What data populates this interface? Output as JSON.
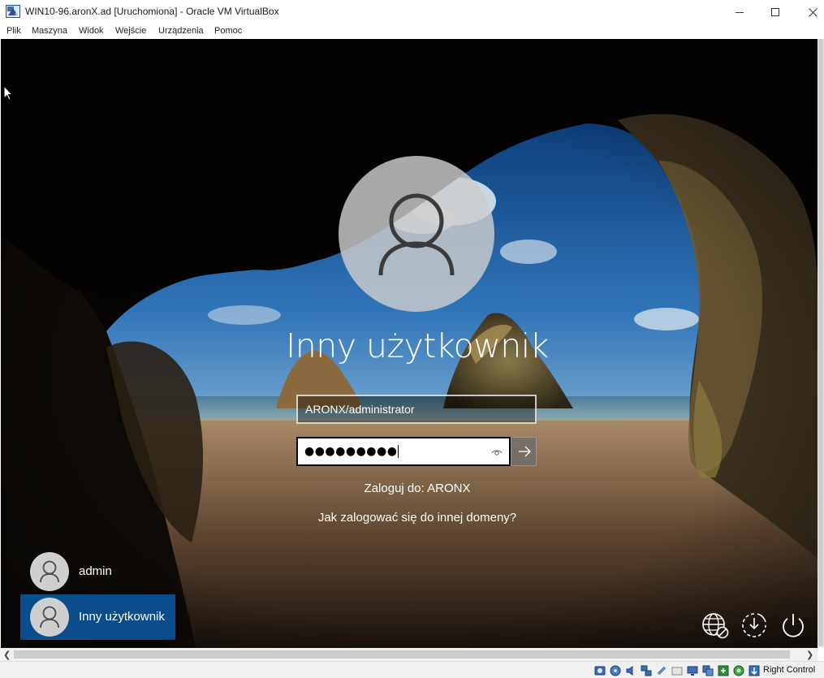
{
  "window": {
    "title": "WIN10-96.aronX.ad [Uruchomiona] - Oracle VM VirtualBox",
    "app_icon": "virtualbox-icon",
    "controls": [
      "minimize-icon",
      "maximize-icon",
      "close-icon"
    ]
  },
  "menu": {
    "items": [
      "Plik",
      "Maszyna",
      "Widok",
      "Wejście",
      "Urządzenia",
      "Pomoc"
    ]
  },
  "login": {
    "avatar_icon": "user-icon",
    "user_title": "Inny użytkownik",
    "username_value": "ARONX/administrator",
    "password_mask": "●●●●●●●●●",
    "reveal_icon": "eye-icon",
    "submit_icon": "arrow-right-icon",
    "domain_text": "Zaloguj do: ARONX",
    "other_domain_link": "Jak zalogować się do innej domeny?"
  },
  "user_list": [
    {
      "name": "admin",
      "selected": false
    },
    {
      "name": "Inny użytkownik",
      "selected": true
    }
  ],
  "system_buttons": [
    "network-icon",
    "ease-of-access-icon",
    "power-icon"
  ],
  "statusbar": {
    "icons": [
      "hard-disk-icon",
      "optical-drive-icon",
      "audio-icon",
      "network-adapter-icon",
      "usb-icon",
      "shared-folders-icon",
      "display-icon",
      "video-capture-icon",
      "recording-icon",
      "cpu-icon",
      "mouse-integration-icon",
      "keyboard-icon"
    ],
    "host_key": "Right Control"
  },
  "colors": {
    "selected_tile": "#0a4d8c",
    "titlebar_bg": "#ffffff",
    "statusbar_bg": "#f0f0f0"
  }
}
